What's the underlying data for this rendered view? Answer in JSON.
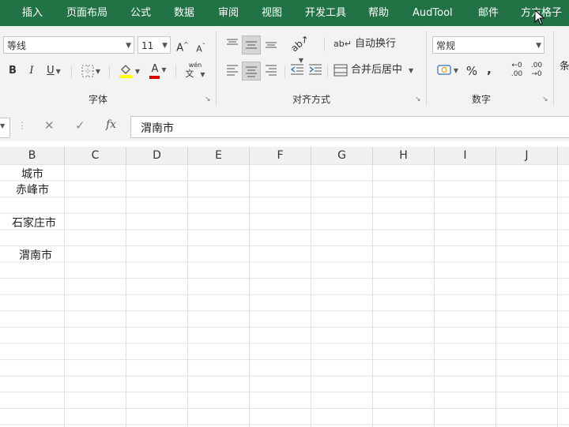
{
  "ribbon_tabs": [
    "插入",
    "页面布局",
    "公式",
    "数据",
    "审阅",
    "视图",
    "开发工具",
    "帮助",
    "AudTool",
    "邮件",
    "方方格子"
  ],
  "font": {
    "name": "等线",
    "size": "11",
    "grow": "A",
    "shrink": "A",
    "bold": "B",
    "italic": "I",
    "underline": "U",
    "font_color": "A",
    "phonetic_top": "wén",
    "phonetic_bottom": "文",
    "group_label": "字体"
  },
  "alignment": {
    "wrap_text": "自动换行",
    "merge_center": "合并后居中",
    "group_label": "对齐方式"
  },
  "number": {
    "format": "常规",
    "percent": "%",
    "comma": ",",
    "inc_decimal_top": "←0",
    "inc_decimal_bottom": ".00",
    "dec_decimal_top": ".00",
    "dec_decimal_bottom": "→0",
    "group_label": "数字"
  },
  "next_group_partial": "条",
  "formula_bar": {
    "cancel": "✕",
    "enter": "✓",
    "fx": "fx",
    "value": "渭南市"
  },
  "columns": [
    "B",
    "C",
    "D",
    "E",
    "F",
    "G",
    "H",
    "I",
    "J"
  ],
  "cells": {
    "header": "城市",
    "r1": "赤峰市",
    "r2": "石家庄市",
    "r3": "渭南市"
  },
  "colors": {
    "tab_bg": "#217346",
    "highlight": "#ffff00",
    "font_red": "#e00000"
  }
}
